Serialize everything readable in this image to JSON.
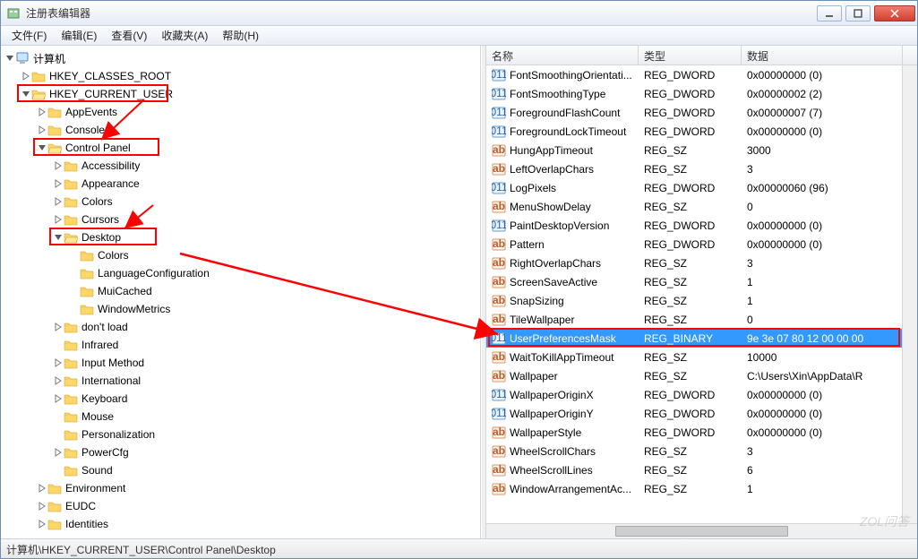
{
  "window": {
    "title": "注册表编辑器"
  },
  "menu": {
    "file": "文件(F)",
    "edit": "编辑(E)",
    "view": "查看(V)",
    "favorites": "收藏夹(A)",
    "help": "帮助(H)"
  },
  "tree": {
    "root": "计算机",
    "items": [
      {
        "level": 1,
        "exp": "col",
        "label": "HKEY_CLASSES_ROOT"
      },
      {
        "level": 1,
        "exp": "exp",
        "label": "HKEY_CURRENT_USER",
        "red": true
      },
      {
        "level": 2,
        "exp": "col",
        "label": "AppEvents"
      },
      {
        "level": 2,
        "exp": "col",
        "label": "Console"
      },
      {
        "level": 2,
        "exp": "exp",
        "label": "Control Panel",
        "red": true
      },
      {
        "level": 3,
        "exp": "col",
        "label": "Accessibility"
      },
      {
        "level": 3,
        "exp": "col",
        "label": "Appearance"
      },
      {
        "level": 3,
        "exp": "col",
        "label": "Colors"
      },
      {
        "level": 3,
        "exp": "col",
        "label": "Cursors"
      },
      {
        "level": 3,
        "exp": "exp",
        "label": "Desktop",
        "red": true
      },
      {
        "level": 4,
        "exp": "none",
        "label": "Colors"
      },
      {
        "level": 4,
        "exp": "none",
        "label": "LanguageConfiguration"
      },
      {
        "level": 4,
        "exp": "none",
        "label": "MuiCached"
      },
      {
        "level": 4,
        "exp": "none",
        "label": "WindowMetrics"
      },
      {
        "level": 3,
        "exp": "col",
        "label": "don't load"
      },
      {
        "level": 3,
        "exp": "none",
        "label": "Infrared"
      },
      {
        "level": 3,
        "exp": "col",
        "label": "Input Method"
      },
      {
        "level": 3,
        "exp": "col",
        "label": "International"
      },
      {
        "level": 3,
        "exp": "col",
        "label": "Keyboard"
      },
      {
        "level": 3,
        "exp": "none",
        "label": "Mouse"
      },
      {
        "level": 3,
        "exp": "none",
        "label": "Personalization"
      },
      {
        "level": 3,
        "exp": "col",
        "label": "PowerCfg"
      },
      {
        "level": 3,
        "exp": "none",
        "label": "Sound"
      },
      {
        "level": 2,
        "exp": "col",
        "label": "Environment"
      },
      {
        "level": 2,
        "exp": "col",
        "label": "EUDC"
      },
      {
        "level": 2,
        "exp": "col",
        "label": "Identities"
      }
    ]
  },
  "list": {
    "header": {
      "name": "名称",
      "type": "类型",
      "data": "数据"
    },
    "rows": [
      {
        "icon": "bin",
        "name": "FontSmoothingOrientati...",
        "type": "REG_DWORD",
        "data": "0x00000000 (0)"
      },
      {
        "icon": "bin",
        "name": "FontSmoothingType",
        "type": "REG_DWORD",
        "data": "0x00000002 (2)"
      },
      {
        "icon": "bin",
        "name": "ForegroundFlashCount",
        "type": "REG_DWORD",
        "data": "0x00000007 (7)"
      },
      {
        "icon": "bin",
        "name": "ForegroundLockTimeout",
        "type": "REG_DWORD",
        "data": "0x00000000 (0)"
      },
      {
        "icon": "str",
        "name": "HungAppTimeout",
        "type": "REG_SZ",
        "data": "3000"
      },
      {
        "icon": "str",
        "name": "LeftOverlapChars",
        "type": "REG_SZ",
        "data": "3"
      },
      {
        "icon": "bin",
        "name": "LogPixels",
        "type": "REG_DWORD",
        "data": "0x00000060 (96)"
      },
      {
        "icon": "str",
        "name": "MenuShowDelay",
        "type": "REG_SZ",
        "data": "0"
      },
      {
        "icon": "bin",
        "name": "PaintDesktopVersion",
        "type": "REG_DWORD",
        "data": "0x00000000 (0)"
      },
      {
        "icon": "str",
        "name": "Pattern",
        "type": "REG_DWORD",
        "data": "0x00000000 (0)"
      },
      {
        "icon": "str",
        "name": "RightOverlapChars",
        "type": "REG_SZ",
        "data": "3"
      },
      {
        "icon": "str",
        "name": "ScreenSaveActive",
        "type": "REG_SZ",
        "data": "1"
      },
      {
        "icon": "str",
        "name": "SnapSizing",
        "type": "REG_SZ",
        "data": "1"
      },
      {
        "icon": "str",
        "name": "TileWallpaper",
        "type": "REG_SZ",
        "data": "0"
      },
      {
        "icon": "bin",
        "name": "UserPreferencesMask",
        "type": "REG_BINARY",
        "data": "9e 3e 07 80 12 00 00 00",
        "selected": true,
        "red": true
      },
      {
        "icon": "str",
        "name": "WaitToKillAppTimeout",
        "type": "REG_SZ",
        "data": "10000"
      },
      {
        "icon": "str",
        "name": "Wallpaper",
        "type": "REG_SZ",
        "data": "C:\\Users\\Xin\\AppData\\R"
      },
      {
        "icon": "bin",
        "name": "WallpaperOriginX",
        "type": "REG_DWORD",
        "data": "0x00000000 (0)"
      },
      {
        "icon": "bin",
        "name": "WallpaperOriginY",
        "type": "REG_DWORD",
        "data": "0x00000000 (0)"
      },
      {
        "icon": "str",
        "name": "WallpaperStyle",
        "type": "REG_DWORD",
        "data": "0x00000000 (0)"
      },
      {
        "icon": "str",
        "name": "WheelScrollChars",
        "type": "REG_SZ",
        "data": "3"
      },
      {
        "icon": "str",
        "name": "WheelScrollLines",
        "type": "REG_SZ",
        "data": "6"
      },
      {
        "icon": "str",
        "name": "WindowArrangementAc...",
        "type": "REG_SZ",
        "data": "1"
      }
    ]
  },
  "statusbar": {
    "path": "计算机\\HKEY_CURRENT_USER\\Control Panel\\Desktop"
  },
  "watermark": "ZOL问答"
}
